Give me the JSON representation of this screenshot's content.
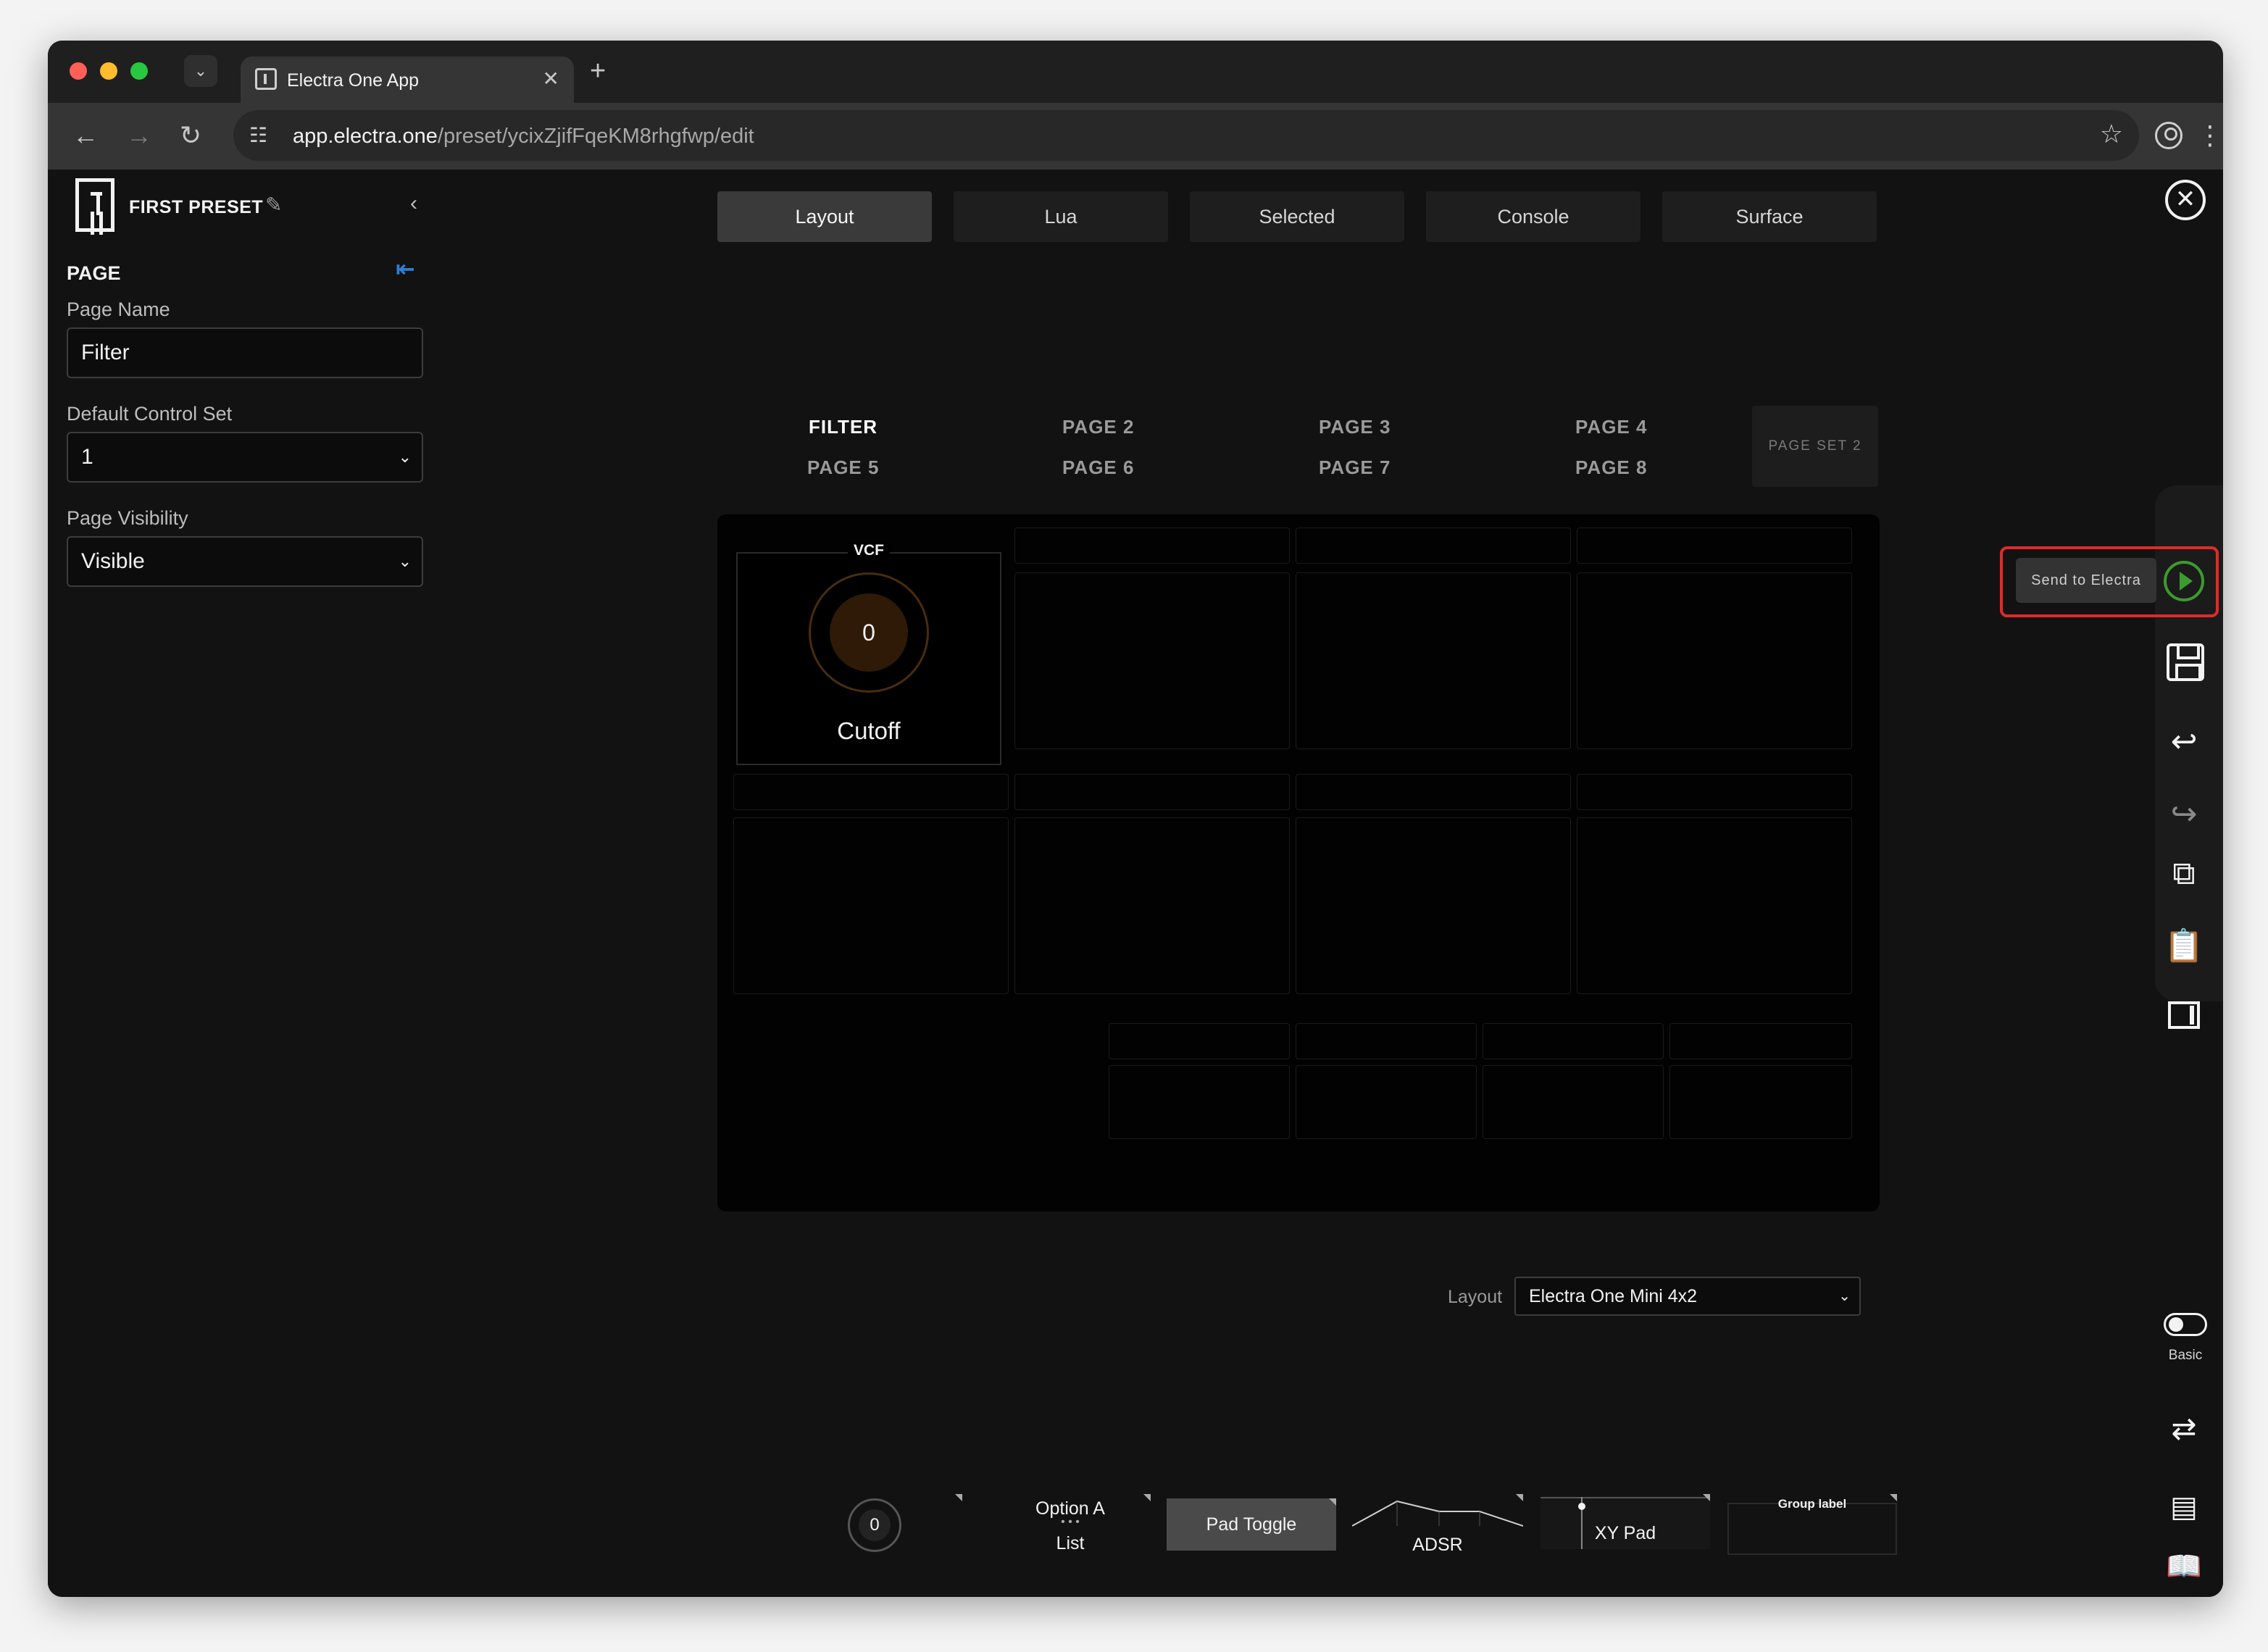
{
  "browser": {
    "tab_title": "Electra One App",
    "tab_close": "✕",
    "new_tab": "+",
    "url_host": "app.electra.one",
    "url_path": "/preset/ycixZjifFqeKM8rhgfwp/edit"
  },
  "sidebar": {
    "preset_name": "FIRST PRESET",
    "section_title": "PAGE",
    "page_name_label": "Page Name",
    "page_name_value": "Filter",
    "control_set_label": "Default Control Set",
    "control_set_value": "1",
    "visibility_label": "Page Visibility",
    "visibility_value": "Visible"
  },
  "top_tabs": [
    {
      "label": "Layout",
      "active": true
    },
    {
      "label": "Lua",
      "active": false
    },
    {
      "label": "Selected",
      "active": false
    },
    {
      "label": "Console",
      "active": false
    },
    {
      "label": "Surface",
      "active": false
    }
  ],
  "pages": [
    {
      "label": "FILTER",
      "active": true
    },
    {
      "label": "PAGE 2"
    },
    {
      "label": "PAGE 3"
    },
    {
      "label": "PAGE 4"
    },
    {
      "label": "PAGE 5"
    },
    {
      "label": "PAGE 6"
    },
    {
      "label": "PAGE 7"
    },
    {
      "label": "PAGE 8"
    }
  ],
  "page_set": "PAGE SET 2",
  "control": {
    "group": "VCF",
    "name": "Cutoff",
    "value": "0",
    "color": "#4a2c0c"
  },
  "layout_label": "Layout",
  "layout_value": "Electra One Mini 4x2",
  "toolbar": {
    "send_label": "Send to Electra",
    "mode_label": "Basic",
    "accent": "#3d9a2e",
    "highlight": "#e02a2a"
  },
  "palette": {
    "knob_value": "0",
    "list_option": "Option A",
    "list_label": "List",
    "pad_label": "Pad Toggle",
    "adsr_label": "ADSR",
    "xy_label": "XY Pad",
    "group_label": "Group label"
  }
}
